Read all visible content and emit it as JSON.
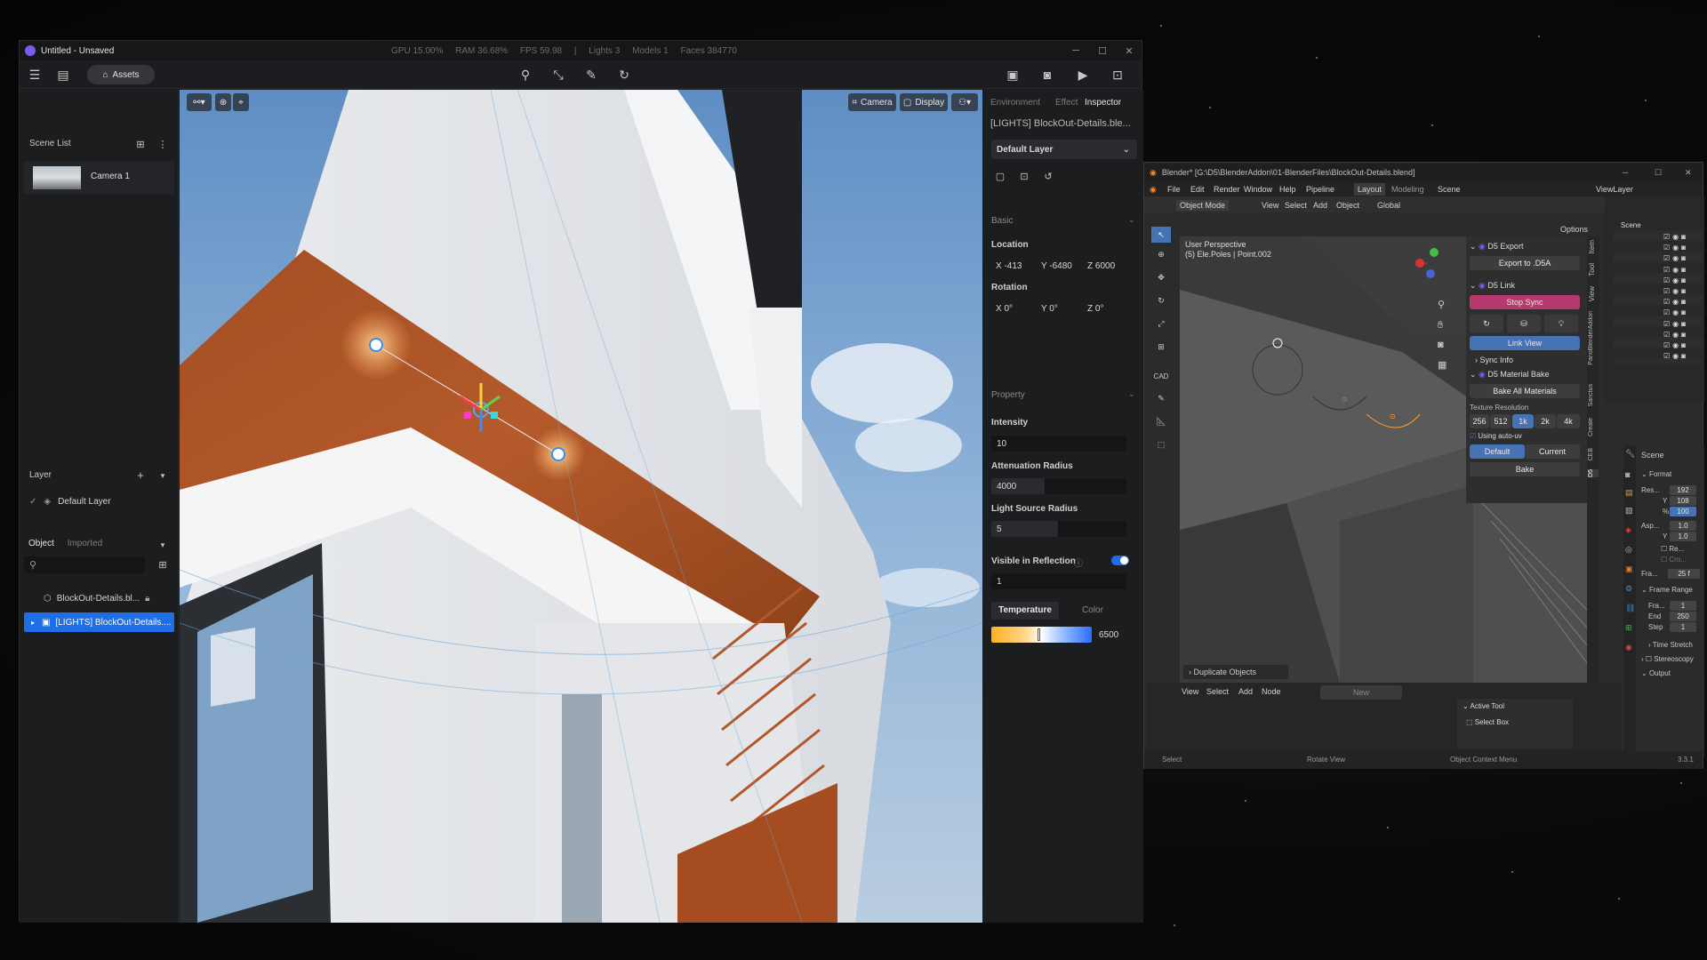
{
  "d5": {
    "title": "Untitled - Unsaved",
    "stats": [
      "GPU 15.00%",
      "RAM 36.68%",
      "FPS 59.98",
      "|",
      "Lights 3",
      "Models 1",
      "Faces 384770"
    ],
    "assets_label": "Assets",
    "scene_list_label": "Scene List",
    "camera_label": "Camera 1",
    "layer_label": "Layer",
    "default_layer": "Default Layer",
    "tab_object": "Object",
    "tab_imported": "Imported",
    "tree_items": [
      "BlockOut-Details.bl...",
      "[LIGHTS] BlockOut-Details...."
    ],
    "viewport_buttons": {
      "camera": "Camera",
      "display": "Display"
    },
    "inspector": {
      "tabs": [
        "Environment",
        "Effect",
        "Inspector"
      ],
      "object_name": "[LIGHTS] BlockOut-Details.ble...",
      "layer_select": "Default Layer",
      "basic": "Basic",
      "location": "Location",
      "loc": {
        "x": "X -413",
        "y": "Y -6480",
        "z": "Z 6000"
      },
      "rotation": "Rotation",
      "rot": {
        "x": "X 0°",
        "y": "Y 0°",
        "z": "Z 0°"
      },
      "property": "Property",
      "intensity_label": "Intensity",
      "intensity": "10",
      "att_radius_label": "Attenuation Radius",
      "att_radius": "4000",
      "light_src_label": "Light Source Radius",
      "light_src": "5",
      "visible_label": "Visible in Reflection",
      "visible_value": "1",
      "temp_tab": "Temperature",
      "color_tab": "Color",
      "temperature": "6500"
    },
    "colors": {
      "accent": "#1e6ee8",
      "panel": "#1c1d1f",
      "fascia": "#b45a2b"
    }
  },
  "blender": {
    "title": "Blender* [G:\\D5\\BlenderAddon\\01-BlenderFiles\\BlockOut-Details.blend]",
    "menus": [
      "File",
      "Edit",
      "Render",
      "Window",
      "Help",
      "Pipeline"
    ],
    "workspaces": [
      "Layout",
      "Modeling"
    ],
    "scene": "Scene",
    "view_layer": "ViewLayer",
    "mode": "Object Mode",
    "header_menu": [
      "View",
      "Select",
      "Add",
      "Object"
    ],
    "orientation": "Global",
    "options": "Options",
    "viewport_text": {
      "line1": "User Perspective",
      "line2": "(5) Ele.Poles | Point.002"
    },
    "cad_label": "CAD",
    "d5_export": "D5 Export",
    "export_btn": "Export to .D5A",
    "d5_link": "D5 Link",
    "stop_sync": "Stop Sync",
    "link_view": "Link View",
    "sync_info": "Sync Info",
    "material_bake": "D5 Material Bake",
    "bake_all": "Bake All Materials",
    "tex_res": "Texture Resolution",
    "res_options": [
      "256",
      "512",
      "1k",
      "2k",
      "4k"
    ],
    "using_autouv": "Using auto-uv",
    "default_btn": "Default",
    "current_btn": "Current",
    "bake_btn": "Bake",
    "duplicate_objects": "Duplicate Objects",
    "side_tabs": [
      "Item",
      "Tool",
      "View",
      "PanoBlenderAddon",
      "Sanctus",
      "Create",
      "CEB",
      "D5"
    ],
    "lower_menus": [
      "View",
      "Select",
      "Add",
      "Node"
    ],
    "new_btn": "New",
    "active_tool": "Active Tool",
    "select_box": "Select Box",
    "outliner_title": "Scene",
    "props": {
      "scene": "Scene",
      "format": "Format",
      "res_label": "Res...",
      "res_x": "192",
      "res_y_label": "Y",
      "res_y": "108",
      "pct_label": "%",
      "pct": "100",
      "asp_label": "Asp...",
      "asp_x": "1.0",
      "asp_y": "1.0",
      "re": "Re...",
      "cro": "Cro...",
      "fra_label": "Fra...",
      "fps": "25 f",
      "frame_range": "Frame Range",
      "start_label": "Fra...",
      "start": "1",
      "end_label": "End",
      "end": "250",
      "step_label": "Step",
      "step": "1",
      "time_stretch": "Time Stretch",
      "stereoscopy": "Stereoscopy",
      "output": "Output"
    },
    "status": {
      "select": "Select",
      "rotate": "Rotate View",
      "context": "Object Context Menu",
      "version": "3.3.1"
    }
  }
}
